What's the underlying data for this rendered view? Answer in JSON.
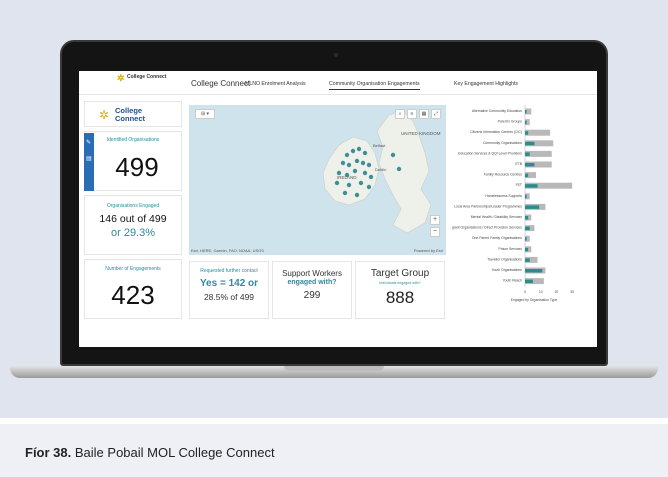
{
  "caption": {
    "prefix": "Fíor 38.",
    "text": "Baile Pobail MOL College Connect"
  },
  "nav": {
    "logo": "College Connect",
    "app_title": "College Connect",
    "tabs": [
      "MLNO Enrolment Analysis",
      "Community Organisation Engagements",
      "Key Engagement Highlights"
    ],
    "active_tab": 1
  },
  "kpi": {
    "brand": "College Connect",
    "identified_label": "Identified Organisations",
    "identified_value": "499",
    "engaged_label": "Organisations Engaged",
    "engaged_line1": "146 out of 499",
    "engaged_line2": "or 29.3%",
    "engagements_label": "Number of Engagements",
    "engagements_value": "423",
    "further_label": "Requested further contact",
    "further_line1": "Yes = 142 or",
    "further_line2": "28.5% of 499",
    "support_title": "Support Workers",
    "support_sub": "engaged with?",
    "support_value": "299",
    "target_title": "Target Group",
    "target_sub": "Individuals engaged with?",
    "target_value": "888"
  },
  "map": {
    "credit_left": "Esri, HERE, Garmin, FAO, NOAA, USGS",
    "credit_right": "Powered by Esri",
    "labels": [
      "UNITED KINGDOM",
      "IRELAND",
      "Belfast",
      "Dublin"
    ]
  },
  "chart_data": {
    "type": "bar",
    "orientation": "horizontal",
    "xlabel": "Engaged by Organisation Type",
    "categories": [
      "Alternative Community Education",
      "Parent's Groups",
      "Citizens Information Centres (CIC)",
      "Community Organisations",
      "Education Services & QQI Level Providers",
      "ETB",
      "Family Resource Centres",
      "FET",
      "Homelessness Supports",
      "Local Area Partnerships/Leader Programmes",
      "Mental Health / Disability Services",
      "Migrant Organisations / Direct Provision Services",
      "One Parent Family Organisations",
      "Prison Services",
      "Traveller Organisations",
      "Youth Organisations",
      "Youth Reach"
    ],
    "series": [
      {
        "values": [
          4,
          3,
          16,
          18,
          17,
          17,
          7,
          30,
          3,
          13,
          4,
          6,
          3,
          4,
          8,
          13,
          12
        ]
      },
      {
        "values": [
          1,
          1,
          2,
          6,
          3,
          6,
          2,
          8,
          1,
          9,
          2,
          3,
          1,
          2,
          3,
          11,
          5
        ]
      }
    ],
    "colors": [
      "#b9b9b9",
      "#2a8c8c"
    ]
  }
}
